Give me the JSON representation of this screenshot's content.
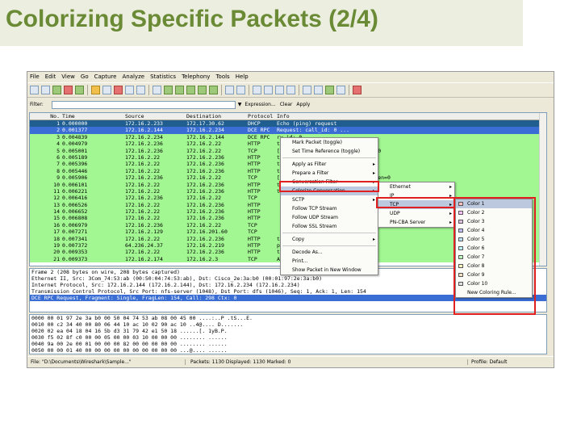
{
  "slide": {
    "title": "Colorizing Specific Packets (2/4)"
  },
  "menubar": [
    "File",
    "Edit",
    "View",
    "Go",
    "Capture",
    "Analyze",
    "Statistics",
    "Telephony",
    "Tools",
    "Help"
  ],
  "filterbar": {
    "label": "Filter:",
    "expression_label": "Expression...",
    "clear_label": "Clear",
    "apply_label": "Apply"
  },
  "packet_list": {
    "columns": [
      "No.",
      "Time",
      "Source",
      "Destination",
      "Protocol",
      "Info"
    ],
    "rows": [
      {
        "no": "1",
        "time": "0.000000",
        "src": "172.16.2.233",
        "dst": "172.17.30.62",
        "proto": "DHCP",
        "info": "Echo (ping) request",
        "style": "dark"
      },
      {
        "no": "2",
        "time": "0.001377",
        "src": "172.16.2.144",
        "dst": "172.16.2.234",
        "proto": "DCE RPC",
        "info": "Request: call_id: 0 ...",
        "style": "sel"
      },
      {
        "no": "3",
        "time": "0.004839",
        "src": "172.16.2.234",
        "dst": "172.16.2.144",
        "proto": "DCE RPC",
        "info": "ry_id: 0",
        "style": "green"
      },
      {
        "no": "4",
        "time": "0.004979",
        "src": "172.16.2.236",
        "dst": "172.16.2.22",
        "proto": "HTTP",
        "info": "traffic",
        "style": "green"
      },
      {
        "no": "5",
        "time": "0.005001",
        "src": "172.16.2.236",
        "dst": "172.16.2.22",
        "proto": "TCP",
        "info": "[ACK] Seq=1 Ack=1 Win=64240 Len=0",
        "style": "green"
      },
      {
        "no": "6",
        "time": "0.005189",
        "src": "172.16.2.22",
        "dst": "172.16.2.236",
        "proto": "HTTP",
        "info": "traffic",
        "style": "green"
      },
      {
        "no": "7",
        "time": "0.005396",
        "src": "172.16.2.22",
        "dst": "172.16.2.236",
        "proto": "HTTP",
        "info": "traffic",
        "style": "green"
      },
      {
        "no": "8",
        "time": "0.005446",
        "src": "172.16.2.22",
        "dst": "172.16.2.236",
        "proto": "HTTP",
        "info": "traffic",
        "style": "green"
      },
      {
        "no": "9",
        "time": "0.005906",
        "src": "172.16.2.236",
        "dst": "172.16.2.22",
        "proto": "TCP",
        "info": "[ACK] Seq=1 Ack=2920 Win=64240 Len=0",
        "style": "green"
      },
      {
        "no": "10",
        "time": "0.006101",
        "src": "172.16.2.22",
        "dst": "172.16.2.236",
        "proto": "HTTP",
        "info": "traffic",
        "style": "green"
      },
      {
        "no": "11",
        "time": "0.006221",
        "src": "172.16.2.22",
        "dst": "172.16.2.236",
        "proto": "HTTP",
        "info": "traffic",
        "style": "green"
      },
      {
        "no": "12",
        "time": "0.006416",
        "src": "172.16.2.236",
        "dst": "172.16.2.22",
        "proto": "TCP",
        "info": "",
        "style": "green"
      },
      {
        "no": "13",
        "time": "0.006526",
        "src": "172.16.2.22",
        "dst": "172.16.2.236",
        "proto": "HTTP",
        "info": "",
        "style": "green"
      },
      {
        "no": "14",
        "time": "0.006652",
        "src": "172.16.2.22",
        "dst": "172.16.2.236",
        "proto": "HTTP",
        "info": "",
        "style": "green"
      },
      {
        "no": "15",
        "time": "0.006808",
        "src": "172.16.2.22",
        "dst": "172.16.2.236",
        "proto": "HTTP",
        "info": "",
        "style": "green"
      },
      {
        "no": "16",
        "time": "0.006979",
        "src": "172.16.2.236",
        "dst": "172.16.2.22",
        "proto": "TCP",
        "info": "",
        "style": "green"
      },
      {
        "no": "17",
        "time": "0.007271",
        "src": "172.16.2.129",
        "dst": "172.16.201.60",
        "proto": "TCP",
        "info": "",
        "style": "green"
      },
      {
        "no": "18",
        "time": "0.007341",
        "src": "172.16.2.22",
        "dst": "172.16.2.236",
        "proto": "HTTP",
        "info": "traffic",
        "style": "green"
      },
      {
        "no": "19",
        "time": "0.007372",
        "src": "64.236.24.37",
        "dst": "172.16.2.219",
        "proto": "HTTP",
        "info": "ple] Ack=40954 Win=64...",
        "style": "green"
      },
      {
        "no": "20",
        "time": "0.009353",
        "src": "172.16.2.22",
        "dst": "172.16.2.236",
        "proto": "HTTP",
        "info": "traffic",
        "style": "green"
      },
      {
        "no": "21",
        "time": "0.009373",
        "src": "172.16.2.174",
        "dst": "172.16.2.3",
        "proto": "TCP",
        "info": "Ack Seq=1 Ack=1 Win=0",
        "style": "green"
      }
    ]
  },
  "detail_lines": [
    "Frame 2 (208 bytes on wire, 208 bytes captured)",
    "Ethernet II, Src: 3Com_74:53:ab (00:50:04:74:53:ab), Dst: Cisco_2e:3a:b0 (00:01:97:2e:3a:b0)",
    "Internet Protocol, Src: 172.16.2.144 (172.16.2.144), Dst: 172.16.2.234 (172.16.2.234)",
    "Transmission Control Protocol, Src Port: nfs-server (1048), Dst Port: dfs (1046), Seq: 1, Ack: 1, Len: 154",
    "DCE RPC Request, Fragment: Single, FragLen: 154, Call: 298 Ctx: 0"
  ],
  "bytes_lines": [
    "0000  00 01 97 2e 3a b0 00 50  04 74 53 ab 08 00 45 00   ....:..P .tS...E.",
    "0010  00 c2 34 40 00 80 06  44 10 ac 10 02 90 ac 10   ..4@.... D.......",
    "0020  02 ea 04 18 04 16 5b d3  31 79 42 e1 50 18   ......[. 1yB.P.",
    "0030  f5 02 8f c0 00 00 05 00  00 03 10 00 00 00   ........ ......",
    "0040  9a 00 2e 00 01 00 00 00  82 00 00 00 00 00   ........ ......",
    "0050  00 00 01 40 00 00 00 00  00 00 00 00 00 00   ...@.... ......"
  ],
  "status": {
    "file": "File: \"D:\\Documents\\Wireshark\\Sample...\"",
    "packets": "Packets: 1130 Displayed: 1130 Marked: 0",
    "profile": "Profile: Default"
  },
  "context_menu": {
    "items": [
      {
        "label": "Mark Packet (toggle)",
        "submenu": false
      },
      {
        "label": "Set Time Reference (toggle)",
        "submenu": false
      },
      {
        "sep": true
      },
      {
        "label": "Apply as Filter",
        "submenu": true
      },
      {
        "label": "Prepare a Filter",
        "submenu": true
      },
      {
        "label": "Conversation Filter",
        "submenu": true
      },
      {
        "label": "Colorize Conversation",
        "submenu": true,
        "highlight": true
      },
      {
        "label": "SCTP",
        "submenu": true
      },
      {
        "label": "Follow TCP Stream",
        "submenu": false
      },
      {
        "label": "Follow UDP Stream",
        "submenu": false
      },
      {
        "label": "Follow SSL Stream",
        "submenu": false
      },
      {
        "sep": true
      },
      {
        "label": "Copy",
        "submenu": true
      },
      {
        "sep": true
      },
      {
        "label": "Decode As...",
        "submenu": false
      },
      {
        "label": "Print...",
        "submenu": false
      },
      {
        "label": "Show Packet in New Window",
        "submenu": false
      }
    ]
  },
  "conversation_menu": {
    "items": [
      {
        "label": "Ethernet",
        "highlight": false
      },
      {
        "label": "IP",
        "highlight": false
      },
      {
        "label": "TCP",
        "highlight": true
      },
      {
        "label": "UDP",
        "highlight": false
      },
      {
        "label": "PN-CBA Server",
        "highlight": false
      }
    ]
  },
  "color_menu": {
    "items": [
      {
        "label": "Color 1",
        "color": "#ffc0c0",
        "highlight": true
      },
      {
        "label": "Color 2",
        "color": "#ffc0ff"
      },
      {
        "label": "Color 3",
        "color": "#e0c0e0"
      },
      {
        "label": "Color 4",
        "color": "#c0c0ff"
      },
      {
        "label": "Color 5",
        "color": "#c0e0ff"
      },
      {
        "label": "Color 6",
        "color": "#c0ffff"
      },
      {
        "label": "Color 7",
        "color": "#c0ffc0"
      },
      {
        "label": "Color 8",
        "color": "#ffffc0"
      },
      {
        "label": "Color 9",
        "color": "#f0e0c0"
      },
      {
        "label": "Color 10",
        "color": "#e0e0e0"
      },
      {
        "label": "New Coloring Rule...",
        "color": ""
      }
    ]
  },
  "colors": {
    "title_green": "#6a8a35",
    "row_green": "#a2f792",
    "selection_blue": "#3a6ed4",
    "annotation_red": "#e02020"
  }
}
